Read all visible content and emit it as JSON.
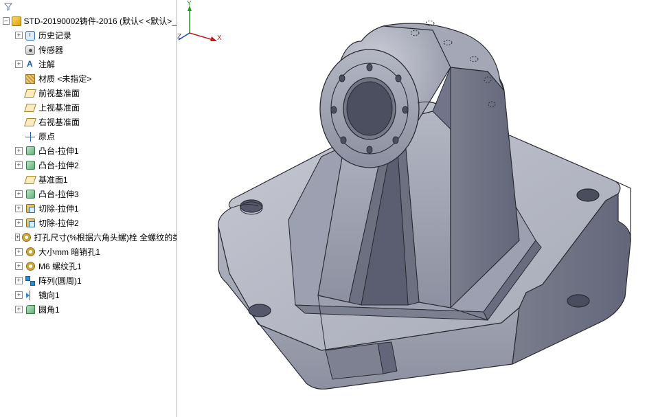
{
  "tree": {
    "root": "STD-20190002铸件-2016  (默认< <默认>_",
    "items": [
      {
        "icon": "hist",
        "label": "历史记录",
        "exp": "+"
      },
      {
        "icon": "sens",
        "label": "传感器",
        "exp": ""
      },
      {
        "icon": "annot",
        "label": "注解",
        "exp": "+"
      },
      {
        "icon": "mat",
        "label": "材质 <未指定>",
        "exp": ""
      },
      {
        "icon": "plane",
        "label": "前视基准面",
        "exp": ""
      },
      {
        "icon": "plane",
        "label": "上视基准面",
        "exp": ""
      },
      {
        "icon": "plane",
        "label": "右视基准面",
        "exp": ""
      },
      {
        "icon": "origin",
        "label": "原点",
        "exp": ""
      },
      {
        "icon": "ext",
        "label": "凸台-拉伸1",
        "exp": "+"
      },
      {
        "icon": "ext",
        "label": "凸台-拉伸2",
        "exp": "+"
      },
      {
        "icon": "plane",
        "label": "基准面1",
        "exp": ""
      },
      {
        "icon": "ext",
        "label": "凸台-拉伸3",
        "exp": "+"
      },
      {
        "icon": "cut",
        "label": "切除-拉伸1",
        "exp": "+"
      },
      {
        "icon": "cut",
        "label": "切除-拉伸2",
        "exp": "+"
      },
      {
        "icon": "hole",
        "label": "打孔尺寸(%根据六角头螺)栓 全螺纹的类",
        "exp": "+"
      },
      {
        "icon": "hole",
        "label": "大小mm 暗销孔1",
        "exp": "+"
      },
      {
        "icon": "hole",
        "label": "M6 螺纹孔1",
        "exp": "+"
      },
      {
        "icon": "patt",
        "label": "阵列(圆周)1",
        "exp": "+"
      },
      {
        "icon": "mirr",
        "label": "镜向1",
        "exp": "+"
      },
      {
        "icon": "fill",
        "label": "圆角1",
        "exp": "+"
      }
    ]
  },
  "triad": {
    "x": "X",
    "y": "Y",
    "z": "Z"
  },
  "colors": {
    "model_light": "#b9bcc7",
    "model_mid": "#9a9eae",
    "model_dark": "#6d7080",
    "edge": "#2a2a33"
  }
}
